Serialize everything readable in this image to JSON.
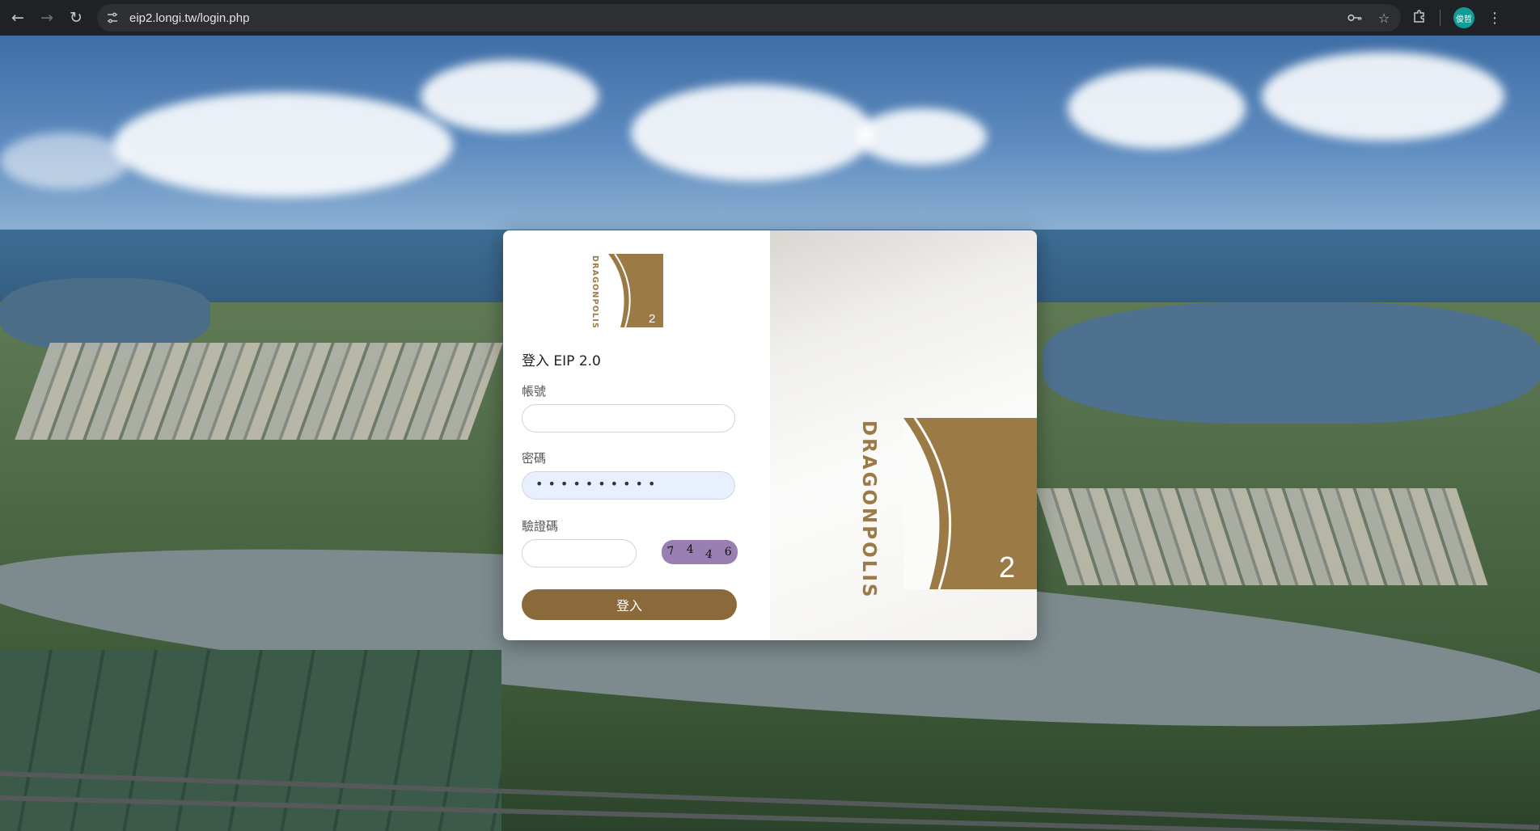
{
  "browser": {
    "url": "eip2.longi.tw/login.php",
    "profile_initials": "俊哲"
  },
  "login": {
    "title": "登入 EIP 2.0",
    "account_label": "帳號",
    "account_value": "",
    "password_label": "密碼",
    "password_mask": "••••••••••",
    "captcha_label": "驗證碼",
    "captcha_value": "",
    "captcha_chars": [
      "7",
      "4",
      "4",
      "6"
    ],
    "submit_label": "登入"
  },
  "brand": {
    "wordmark": "DRAGONPOLIS",
    "number": "2",
    "color": "#9b7a45"
  }
}
